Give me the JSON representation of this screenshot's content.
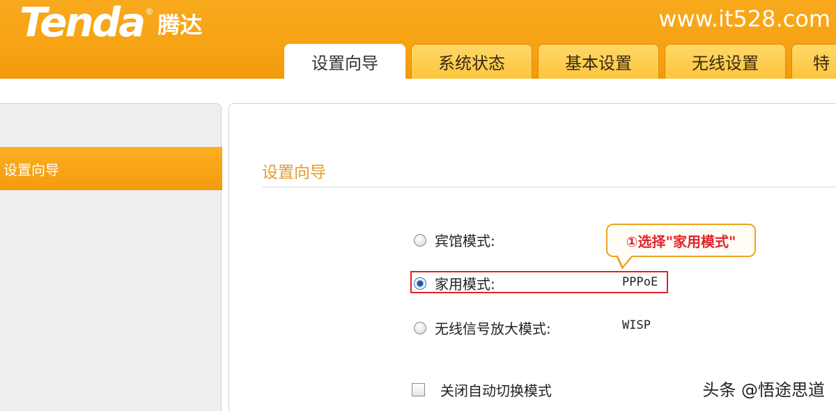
{
  "header": {
    "logo_text": "Tenda",
    "logo_reg": "®",
    "logo_cn": "腾达",
    "site_url": "www.it528.com"
  },
  "tabs": [
    {
      "label": "设置向导",
      "active": true
    },
    {
      "label": "系统状态",
      "active": false
    },
    {
      "label": "基本设置",
      "active": false
    },
    {
      "label": "无线设置",
      "active": false
    },
    {
      "label": "特",
      "active": false
    }
  ],
  "sidebar": {
    "items": [
      {
        "label": "设置向导",
        "active": true
      }
    ]
  },
  "main": {
    "title": "设置向导",
    "options": [
      {
        "label": "宾馆模式:",
        "value": "",
        "checked": false
      },
      {
        "label": "家用模式:",
        "value": "PPPoE",
        "checked": true
      },
      {
        "label": "无线信号放大模式:",
        "value": "WISP",
        "checked": false
      }
    ],
    "checkbox": {
      "label": "关闭自动切换模式",
      "checked": false
    }
  },
  "annotation": {
    "callout": "①选择\"家用模式\"",
    "highlight_color": "#e0202a"
  },
  "watermark": "头条 @悟途思道",
  "colors": {
    "header_orange": "#f6a313",
    "title_orange": "#e59a2a",
    "callout_red": "#e2232a"
  }
}
